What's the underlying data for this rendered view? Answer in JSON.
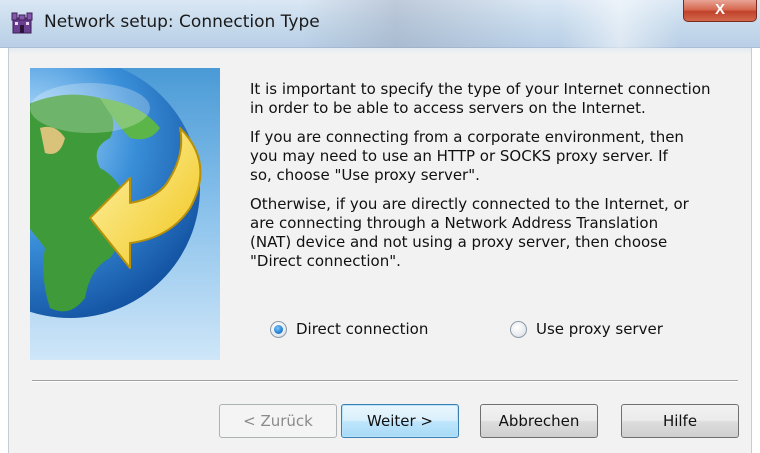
{
  "window": {
    "title": "Network setup: Connection Type",
    "close_label": "X"
  },
  "icons": {
    "app_icon": "castle-icon",
    "wizard_image": "globe-arrow-image"
  },
  "description": {
    "paragraph1": "It is important to specify the type of your Internet connection\nin order to be able to access servers on the Internet.",
    "paragraph2": "If you are connecting from a corporate environment, then\nyou may need to use an HTTP or SOCKS proxy server. If\nso, choose \"Use proxy server\".",
    "paragraph3": "Otherwise, if you are directly connected to the Internet, or\nare connecting through a Network Address Translation\n(NAT) device and not using a proxy server, then choose\n\"Direct connection\"."
  },
  "options": {
    "direct_label": "Direct connection",
    "proxy_label": "Use proxy server",
    "selected": "direct"
  },
  "buttons": {
    "back_label": "< Zurück",
    "next_label": "Weiter >",
    "cancel_label": "Abbrechen",
    "help_label": "Hilfe"
  },
  "colors": {
    "accent": "#3c7fb1",
    "radio_selected": "#2b87d8",
    "close_button": "#c0422b"
  }
}
